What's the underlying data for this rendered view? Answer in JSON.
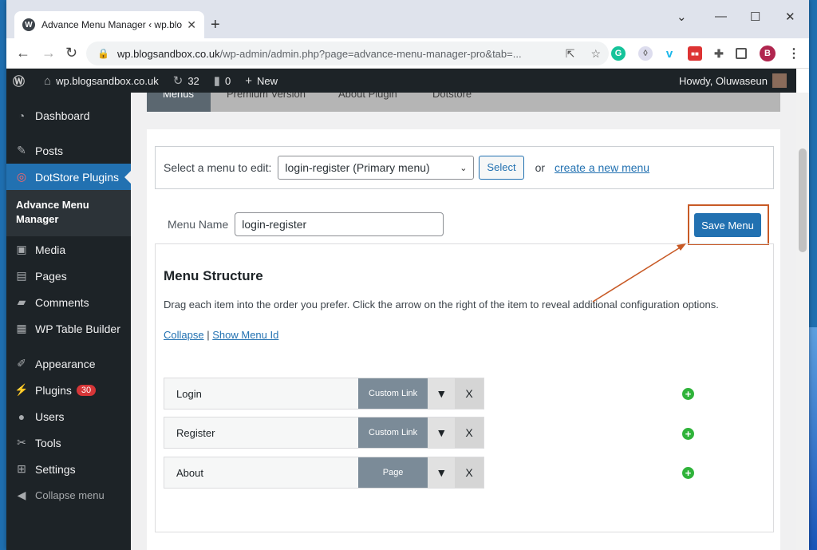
{
  "browser": {
    "tab_title": "Advance Menu Manager ‹ wp.blo",
    "tab_close": "✕",
    "new_tab": "+",
    "url_host": "wp.blogsandbox.co.uk",
    "url_path": "/wp-admin/admin.php?page=advance-menu-manager-pro&tab=...",
    "profile_initial": "B",
    "window_controls": {
      "minimize": "⌄",
      "restore": "—",
      "maximize": "☐",
      "close": "✕"
    }
  },
  "adminbar": {
    "site_name": "wp.blogsandbox.co.uk",
    "updates_count": "32",
    "comments_count": "0",
    "new_label": "New",
    "howdy": "Howdy, Oluwaseun"
  },
  "sidebar": {
    "items": [
      {
        "label": "Dashboard",
        "icon": "dashboard-icon"
      },
      {
        "label": "Posts",
        "icon": "pin-icon"
      },
      {
        "label": "DotStore Plugins",
        "icon": "dotstore-icon"
      },
      {
        "label": "Media",
        "icon": "media-icon"
      },
      {
        "label": "Pages",
        "icon": "pages-icon"
      },
      {
        "label": "Comments",
        "icon": "comments-icon"
      },
      {
        "label": "WP Table Builder",
        "icon": "table-icon"
      },
      {
        "label": "Appearance",
        "icon": "brush-icon"
      },
      {
        "label": "Plugins",
        "icon": "plugin-icon",
        "badge": "30"
      },
      {
        "label": "Users",
        "icon": "users-icon"
      },
      {
        "label": "Tools",
        "icon": "wrench-icon"
      },
      {
        "label": "Settings",
        "icon": "settings-icon"
      }
    ],
    "submenu_label": "Advance Menu Manager",
    "collapse_label": "Collapse menu"
  },
  "content": {
    "tabs": [
      "Menus",
      "Premium Version",
      "About Plugin",
      "Dotstore"
    ],
    "select_prompt": "Select a menu to edit:",
    "selected_menu": "login-register (Primary menu)",
    "select_button": "Select",
    "or_text": "or",
    "create_link": "create a new menu",
    "menu_name_label": "Menu Name",
    "menu_name_value": "login-register",
    "save_button": "Save Menu",
    "structure_title": "Menu Structure",
    "structure_desc": "Drag each item into the order you prefer. Click the arrow on the right of the item to reveal additional configuration options.",
    "collapse_link": "Collapse",
    "separator": "|",
    "show_id_link": "Show Menu Id",
    "menu_items": [
      {
        "label": "Login",
        "type": "Custom Link"
      },
      {
        "label": "Register",
        "type": "Custom Link"
      },
      {
        "label": "About",
        "type": "Page"
      }
    ],
    "delete_glyph": "X",
    "add_glyph": "+"
  },
  "colors": {
    "accent": "#2271b1",
    "admin_dark": "#1d2327",
    "highlight_orange": "#c85a26",
    "add_green": "#2fb33a"
  }
}
